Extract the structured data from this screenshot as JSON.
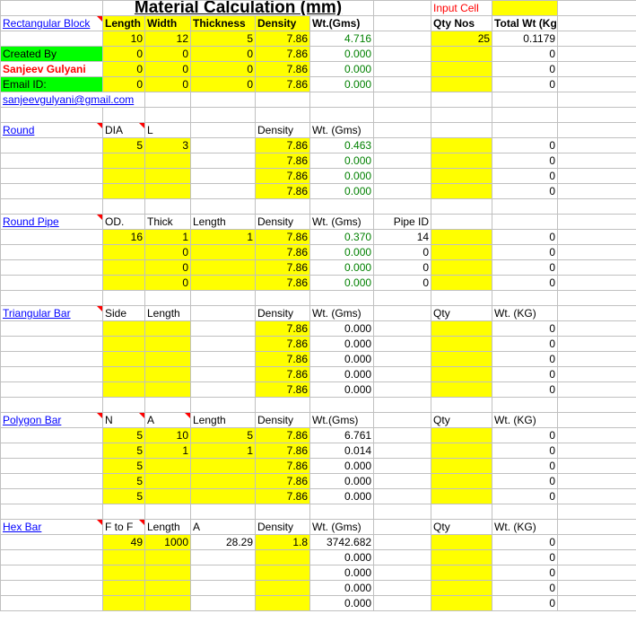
{
  "title": "Material Calculation (mm)",
  "legend": {
    "label": "Input Cell"
  },
  "rect": {
    "name": "Rectangular Block",
    "headers": [
      "Length",
      "Width",
      "Thickness",
      "Density",
      "Wt.(Gms)",
      "",
      "Qty Nos",
      "Total Wt (Kg)"
    ],
    "side": [
      "",
      "Created By",
      "Sanjeev Gulyani",
      "Email ID:"
    ],
    "email": "sanjeevgulyani@gmail.com",
    "rows": [
      [
        "10",
        "12",
        "5",
        "7.86",
        "4.716",
        "",
        "25",
        "0.1179"
      ],
      [
        "0",
        "0",
        "0",
        "7.86",
        "0.000",
        "",
        "",
        "0"
      ],
      [
        "0",
        "0",
        "0",
        "7.86",
        "0.000",
        "",
        "",
        "0"
      ],
      [
        "0",
        "0",
        "0",
        "7.86",
        "0.000",
        "",
        "",
        "0"
      ]
    ]
  },
  "round": {
    "name": "Round",
    "headers": [
      "DIA",
      "L",
      "",
      "Density",
      "Wt. (Gms)",
      "",
      "",
      ""
    ],
    "rows": [
      [
        "5",
        "3",
        "",
        "7.86",
        "0.463",
        "",
        "",
        "0"
      ],
      [
        "",
        "",
        "",
        "7.86",
        "0.000",
        "",
        "",
        "0"
      ],
      [
        "",
        "",
        "",
        "7.86",
        "0.000",
        "",
        "",
        "0"
      ],
      [
        "",
        "",
        "",
        "7.86",
        "0.000",
        "",
        "",
        "0"
      ]
    ]
  },
  "pipe": {
    "name": "Round Pipe",
    "headers": [
      "OD.",
      "Thick",
      "Length",
      "Density",
      "Wt. (Gms)",
      "Pipe ID",
      "",
      ""
    ],
    "rows": [
      [
        "16",
        "1",
        "1",
        "7.86",
        "0.370",
        "14",
        "",
        "0"
      ],
      [
        "",
        "0",
        "",
        "7.86",
        "0.000",
        "0",
        "",
        "0"
      ],
      [
        "",
        "0",
        "",
        "7.86",
        "0.000",
        "0",
        "",
        "0"
      ],
      [
        "",
        "0",
        "",
        "7.86",
        "0.000",
        "0",
        "",
        "0"
      ]
    ]
  },
  "tri": {
    "name": "Triangular Bar",
    "headers": [
      "Side",
      "Length",
      "",
      "Density",
      "Wt. (Gms)",
      "",
      "Qty",
      "Wt. (KG)"
    ],
    "rows": [
      [
        "",
        "",
        "",
        "7.86",
        "0.000",
        "",
        "",
        "0"
      ],
      [
        "",
        "",
        "",
        "7.86",
        "0.000",
        "",
        "",
        "0"
      ],
      [
        "",
        "",
        "",
        "7.86",
        "0.000",
        "",
        "",
        "0"
      ],
      [
        "",
        "",
        "",
        "7.86",
        "0.000",
        "",
        "",
        "0"
      ],
      [
        "",
        "",
        "",
        "7.86",
        "0.000",
        "",
        "",
        "0"
      ]
    ]
  },
  "poly": {
    "name": "Polygon Bar",
    "headers": [
      "N",
      "A",
      "Length",
      "Density",
      "Wt.(Gms)",
      "",
      "Qty",
      "Wt. (KG)"
    ],
    "rows": [
      [
        "5",
        "10",
        "5",
        "7.86",
        "6.761",
        "",
        "",
        "0"
      ],
      [
        "5",
        "1",
        "1",
        "7.86",
        "0.014",
        "",
        "",
        "0"
      ],
      [
        "5",
        "",
        "",
        "7.86",
        "0.000",
        "",
        "",
        "0"
      ],
      [
        "5",
        "",
        "",
        "7.86",
        "0.000",
        "",
        "",
        "0"
      ],
      [
        "5",
        "",
        "",
        "7.86",
        "0.000",
        "",
        "",
        "0"
      ]
    ]
  },
  "hex": {
    "name": "Hex Bar",
    "headers": [
      "F to F",
      "Length",
      "A",
      "Density",
      "Wt. (Gms)",
      "",
      "Qty",
      "Wt. (KG)"
    ],
    "rows": [
      [
        "49",
        "1000",
        "28.29",
        "1.8",
        "3742.682",
        "",
        "",
        "0"
      ],
      [
        "",
        "",
        "",
        "",
        "0.000",
        "",
        "",
        "0"
      ],
      [
        "",
        "",
        "",
        "",
        "0.000",
        "",
        "",
        "0"
      ],
      [
        "",
        "",
        "",
        "",
        "0.000",
        "",
        "",
        "0"
      ],
      [
        "",
        "",
        "",
        "",
        "0.000",
        "",
        "",
        "0"
      ]
    ]
  }
}
